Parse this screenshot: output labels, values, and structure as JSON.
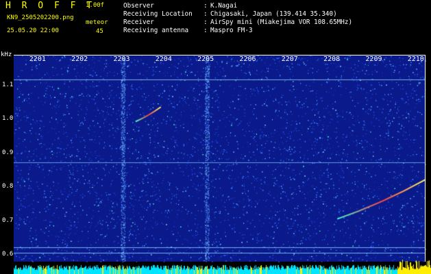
{
  "header": {
    "app_title": "H R O F F T",
    "version": "1.00f",
    "filename": "KN9_2505202200.png",
    "datetime": "25.05.20 22:00",
    "mode": "meteor",
    "count": "45",
    "meta": [
      {
        "label": "Observer",
        "value": "K.Nagai"
      },
      {
        "label": "Receiving Location",
        "value": "Chigasaki, Japan (139.414 35.340)"
      },
      {
        "label": "Receiver",
        "value": "AirSpy mini (Miakejima VOR 108.65MHz)"
      },
      {
        "label": "Receiving antenna",
        "value": "Maspro FM-3"
      }
    ]
  },
  "chart_data": {
    "type": "heatmap",
    "title": "",
    "ylabel": "kHz",
    "x_ticks": [
      "2201",
      "2202",
      "2203",
      "2204",
      "2205",
      "2206",
      "2207",
      "2208",
      "2209",
      "2210"
    ],
    "y_ticks": [
      "1.1",
      "1.0",
      "0.9",
      "0.8",
      "0.7",
      "0.6"
    ],
    "ylim": [
      0.58,
      1.19
    ],
    "xlim": [
      2200.4,
      2210.2
    ],
    "background_color": "#0a1a8a",
    "noise_color": "#3a7bff",
    "horizontal_lines": [
      1.117,
      0.872,
      0.622,
      0.606
    ],
    "vertical_lines": [
      2203.0,
      2205.0
    ],
    "echoes": [
      {
        "start": [
          2203.3,
          0.993
        ],
        "end": [
          2203.9,
          1.036
        ],
        "color": "#ff4040"
      },
      {
        "start": [
          2208.1,
          0.706
        ],
        "end": [
          2210.2,
          0.822
        ],
        "color": "#ff4040"
      }
    ],
    "bottom_bar_color": "#00e5ff"
  }
}
